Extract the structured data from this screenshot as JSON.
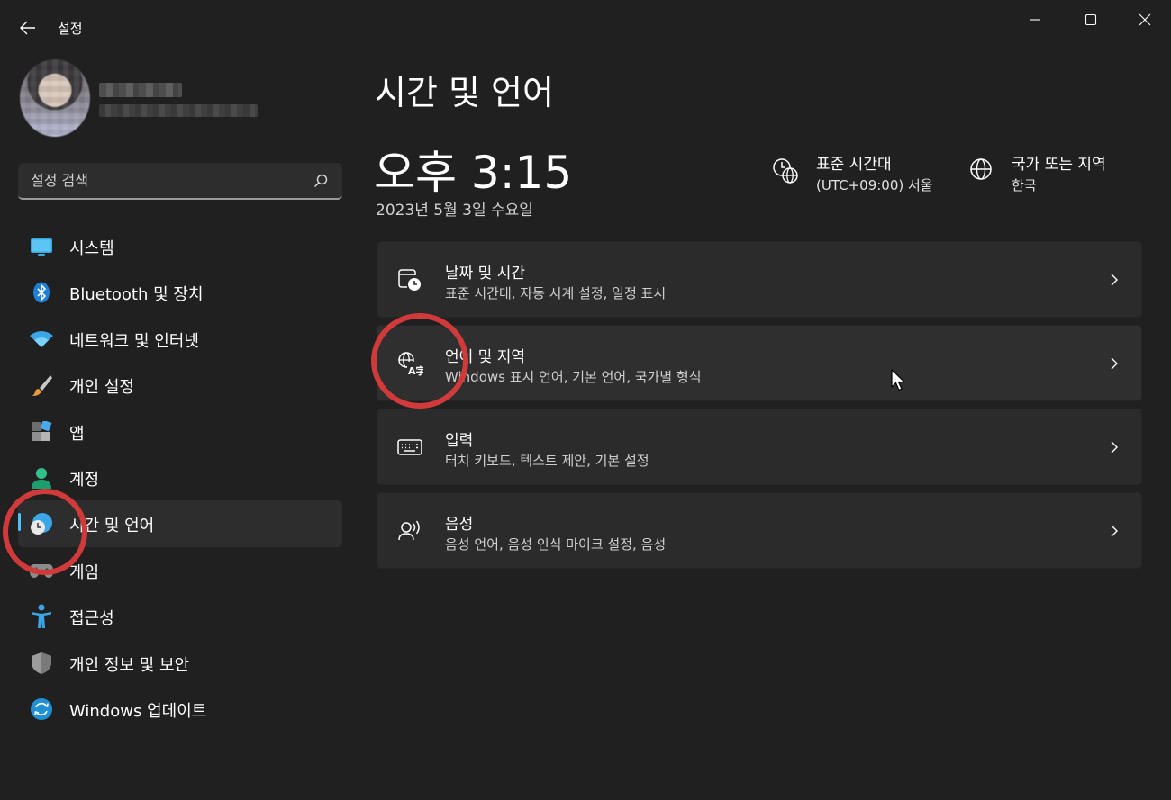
{
  "window": {
    "title": "설정"
  },
  "search": {
    "placeholder": "설정 검색"
  },
  "nav": {
    "items": [
      {
        "label": "시스템",
        "icon": "system-icon"
      },
      {
        "label": "Bluetooth 및 장치",
        "icon": "bluetooth-icon"
      },
      {
        "label": "네트워크 및 인터넷",
        "icon": "wifi-icon"
      },
      {
        "label": "개인 설정",
        "icon": "brush-icon"
      },
      {
        "label": "앱",
        "icon": "apps-icon"
      },
      {
        "label": "계정",
        "icon": "account-icon"
      },
      {
        "label": "시간 및 언어",
        "icon": "time-language-icon",
        "selected": true
      },
      {
        "label": "게임",
        "icon": "gamepad-icon"
      },
      {
        "label": "접근성",
        "icon": "accessibility-icon"
      },
      {
        "label": "개인 정보 및 보안",
        "icon": "shield-icon"
      },
      {
        "label": "Windows 업데이트",
        "icon": "update-icon"
      }
    ]
  },
  "main": {
    "title": "시간 및 언어",
    "clock": {
      "time": "오후 3:15",
      "date": "2023년 5월 3일 수요일"
    },
    "timezone": {
      "title": "표준 시간대",
      "value": "(UTC+09:00) 서울"
    },
    "region": {
      "title": "국가 또는 지역",
      "value": "한국"
    },
    "cards": [
      {
        "title": "날짜 및 시간",
        "description": "표준 시간대, 자동 시계 설정, 일정 표시",
        "icon": "calendar-clock-icon"
      },
      {
        "title": "언어 및 지역",
        "description": "Windows 표시 언어, 기본 언어, 국가별 형식",
        "icon": "language-icon"
      },
      {
        "title": "입력",
        "description": "터치 키보드, 텍스트 제안, 기본 설정",
        "icon": "keyboard-icon"
      },
      {
        "title": "음성",
        "description": "음성 언어, 음성 인식 마이크 설정, 음성",
        "icon": "speech-icon"
      }
    ]
  },
  "colors": {
    "accent": "#4cc2ff",
    "background": "#202020",
    "card": "#2b2b2b",
    "annotation": "#d03a3a"
  }
}
